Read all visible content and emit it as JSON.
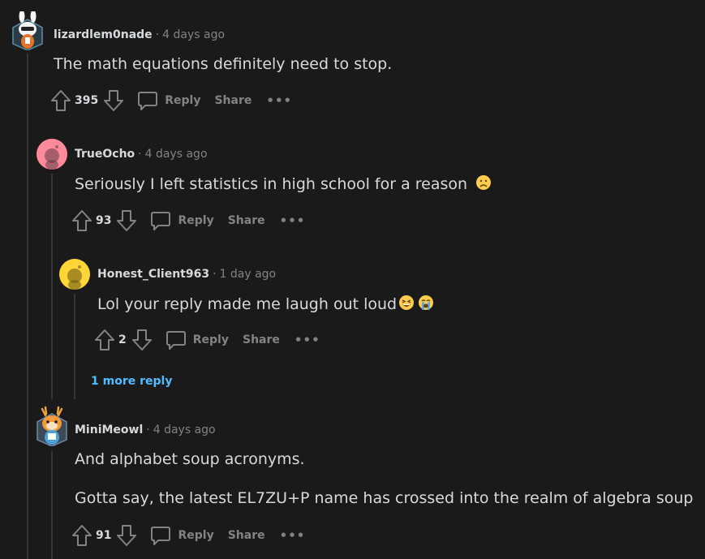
{
  "comments": [
    {
      "username": "lizardlem0nade",
      "separator": "·",
      "time": "4 days ago",
      "body": "The math equations definitely need to stop.",
      "votes": "395",
      "reply_label": "Reply",
      "share_label": "Share",
      "more_label": "•••",
      "avatar": "snoo-bunny-avatar"
    },
    {
      "username": "TrueOcho",
      "separator": "·",
      "time": "4 days ago",
      "body": "Seriously I left statistics in high school for a reason",
      "body_emoji": "worried-face",
      "votes": "93",
      "reply_label": "Reply",
      "share_label": "Share",
      "more_label": "•••",
      "avatar": "default-pink-avatar"
    },
    {
      "username": "Honest_Client963",
      "separator": "·",
      "time": "1 day ago",
      "body": "Lol your reply made me laugh out loud",
      "body_emoji": [
        "grinning-squinting-face",
        "loudly-crying-face"
      ],
      "votes": "2",
      "reply_label": "Reply",
      "share_label": "Share",
      "more_label": "•••",
      "more_replies": "1 more reply",
      "avatar": "default-yellow-avatar"
    },
    {
      "username": "MiniMeowl",
      "separator": "·",
      "time": "4 days ago",
      "body": "And alphabet soup acronyms.",
      "body2": "Gotta say, the latest EL7ZU+P name has crossed into the realm of algebra soup",
      "votes": "91",
      "reply_label": "Reply",
      "share_label": "Share",
      "more_label": "•••",
      "avatar": "snoo-deer-avatar"
    }
  ],
  "colors": {
    "background": "#1a1a1b",
    "text": "#d7dadc",
    "muted": "#818384",
    "link": "#4fbcff",
    "thread_line": "#343536"
  }
}
